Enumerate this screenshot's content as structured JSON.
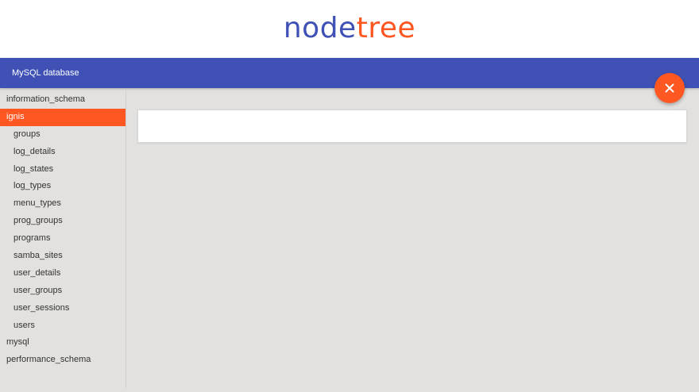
{
  "logo": {
    "part1": "node",
    "part2": "tree"
  },
  "app_bar": {
    "title": "MySQL database"
  },
  "fab": {
    "icon": "close-icon"
  },
  "colors": {
    "primary": "#3f51b5",
    "accent": "#ff5722"
  },
  "tree": [
    {
      "label": "information_schema",
      "level": 0,
      "selected": false
    },
    {
      "label": "ignis",
      "level": 0,
      "selected": true
    },
    {
      "label": "groups",
      "level": 1,
      "selected": false
    },
    {
      "label": "log_details",
      "level": 1,
      "selected": false
    },
    {
      "label": "log_states",
      "level": 1,
      "selected": false
    },
    {
      "label": "log_types",
      "level": 1,
      "selected": false
    },
    {
      "label": "menu_types",
      "level": 1,
      "selected": false
    },
    {
      "label": "prog_groups",
      "level": 1,
      "selected": false
    },
    {
      "label": "programs",
      "level": 1,
      "selected": false
    },
    {
      "label": "samba_sites",
      "level": 1,
      "selected": false
    },
    {
      "label": "user_details",
      "level": 1,
      "selected": false
    },
    {
      "label": "user_groups",
      "level": 1,
      "selected": false
    },
    {
      "label": "user_sessions",
      "level": 1,
      "selected": false
    },
    {
      "label": "users",
      "level": 1,
      "selected": false
    },
    {
      "label": "mysql",
      "level": 0,
      "selected": false
    },
    {
      "label": "performance_schema",
      "level": 0,
      "selected": false
    }
  ]
}
